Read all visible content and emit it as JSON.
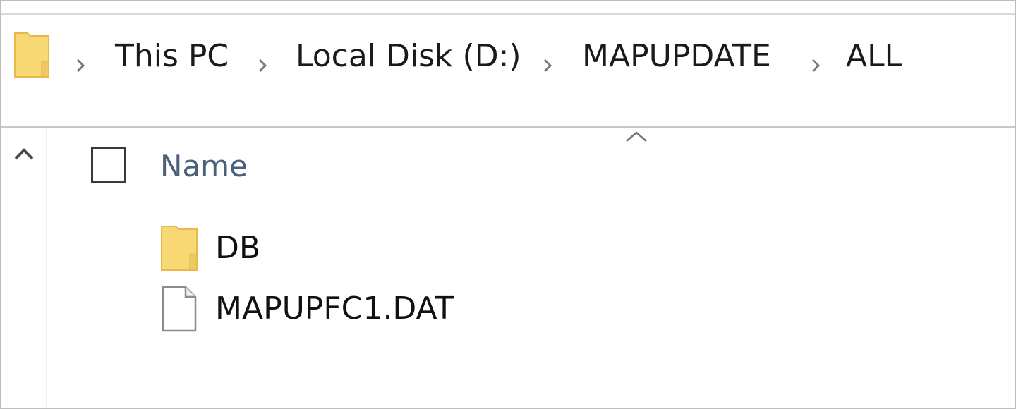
{
  "address_bar": {
    "breadcrumbs": [
      {
        "label": "This PC"
      },
      {
        "label": "Local Disk (D:)"
      },
      {
        "label": "MAPUPDATE"
      },
      {
        "label": "ALL"
      }
    ]
  },
  "file_list": {
    "column_name": "Name",
    "items": [
      {
        "name": "DB",
        "type": "folder",
        "icon": "folder-icon"
      },
      {
        "name": "MAPUPFC1.DAT",
        "type": "file",
        "icon": "document-icon"
      }
    ]
  },
  "colors": {
    "folder": "#F8D775",
    "folder_dark": "#E6B94A",
    "column_header_text": "#4C607A"
  }
}
